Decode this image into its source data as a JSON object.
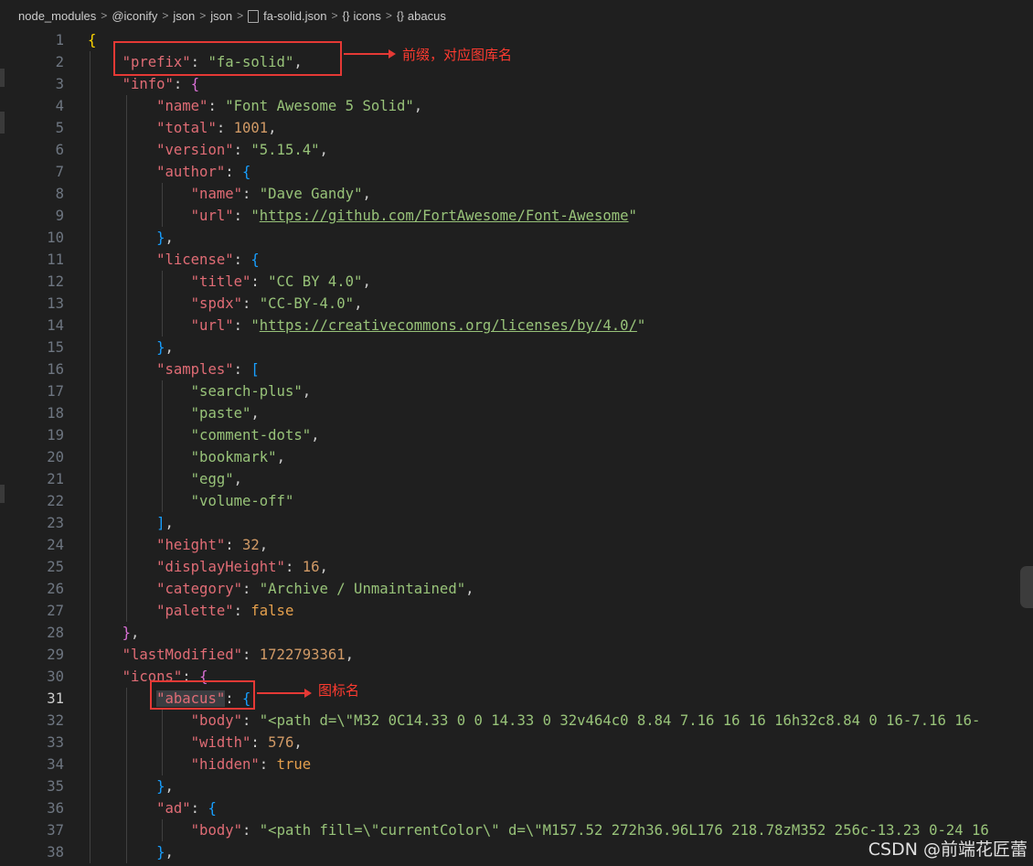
{
  "breadcrumb": [
    "node_modules",
    "@iconify",
    "json",
    "json",
    "fa-solid.json",
    "icons",
    "abacus"
  ],
  "annotations": {
    "prefix_note": "前缀，对应图库名",
    "icon_note": "图标名"
  },
  "watermark": "CSDN @前端花匠蕾",
  "active_line": 31,
  "lines": [
    [
      [
        "br1",
        "{"
      ]
    ],
    [
      [
        "k",
        "\"prefix\""
      ],
      [
        "p",
        ": "
      ],
      [
        "s",
        "\"fa-solid\""
      ],
      [
        "p",
        ","
      ]
    ],
    [
      [
        "k",
        "\"info\""
      ],
      [
        "p",
        ": "
      ],
      [
        "br2",
        "{"
      ]
    ],
    [
      [
        "k",
        "\"name\""
      ],
      [
        "p",
        ": "
      ],
      [
        "s",
        "\"Font Awesome 5 Solid\""
      ],
      [
        "p",
        ","
      ]
    ],
    [
      [
        "k",
        "\"total\""
      ],
      [
        "p",
        ": "
      ],
      [
        "n",
        "1001"
      ],
      [
        "p",
        ","
      ]
    ],
    [
      [
        "k",
        "\"version\""
      ],
      [
        "p",
        ": "
      ],
      [
        "s",
        "\"5.15.4\""
      ],
      [
        "p",
        ","
      ]
    ],
    [
      [
        "k",
        "\"author\""
      ],
      [
        "p",
        ": "
      ],
      [
        "br3",
        "{"
      ]
    ],
    [
      [
        "k",
        "\"name\""
      ],
      [
        "p",
        ": "
      ],
      [
        "s",
        "\"Dave Gandy\""
      ],
      [
        "p",
        ","
      ]
    ],
    [
      [
        "k",
        "\"url\""
      ],
      [
        "p",
        ": "
      ],
      [
        "s",
        "\""
      ],
      [
        "su",
        "https://github.com/FortAwesome/Font-Awesome"
      ],
      [
        "s",
        "\""
      ]
    ],
    [
      [
        "br3",
        "}"
      ],
      [
        "p",
        ","
      ]
    ],
    [
      [
        "k",
        "\"license\""
      ],
      [
        "p",
        ": "
      ],
      [
        "br3",
        "{"
      ]
    ],
    [
      [
        "k",
        "\"title\""
      ],
      [
        "p",
        ": "
      ],
      [
        "s",
        "\"CC BY 4.0\""
      ],
      [
        "p",
        ","
      ]
    ],
    [
      [
        "k",
        "\"spdx\""
      ],
      [
        "p",
        ": "
      ],
      [
        "s",
        "\"CC-BY-4.0\""
      ],
      [
        "p",
        ","
      ]
    ],
    [
      [
        "k",
        "\"url\""
      ],
      [
        "p",
        ": "
      ],
      [
        "s",
        "\""
      ],
      [
        "su",
        "https://creativecommons.org/licenses/by/4.0/"
      ],
      [
        "s",
        "\""
      ]
    ],
    [
      [
        "br3",
        "}"
      ],
      [
        "p",
        ","
      ]
    ],
    [
      [
        "k",
        "\"samples\""
      ],
      [
        "p",
        ": "
      ],
      [
        "br3",
        "["
      ]
    ],
    [
      [
        "s",
        "\"search-plus\""
      ],
      [
        "p",
        ","
      ]
    ],
    [
      [
        "s",
        "\"paste\""
      ],
      [
        "p",
        ","
      ]
    ],
    [
      [
        "s",
        "\"comment-dots\""
      ],
      [
        "p",
        ","
      ]
    ],
    [
      [
        "s",
        "\"bookmark\""
      ],
      [
        "p",
        ","
      ]
    ],
    [
      [
        "s",
        "\"egg\""
      ],
      [
        "p",
        ","
      ]
    ],
    [
      [
        "s",
        "\"volume-off\""
      ]
    ],
    [
      [
        "br3",
        "]"
      ],
      [
        "p",
        ","
      ]
    ],
    [
      [
        "k",
        "\"height\""
      ],
      [
        "p",
        ": "
      ],
      [
        "n",
        "32"
      ],
      [
        "p",
        ","
      ]
    ],
    [
      [
        "k",
        "\"displayHeight\""
      ],
      [
        "p",
        ": "
      ],
      [
        "n",
        "16"
      ],
      [
        "p",
        ","
      ]
    ],
    [
      [
        "k",
        "\"category\""
      ],
      [
        "p",
        ": "
      ],
      [
        "s",
        "\"Archive / Unmaintained\""
      ],
      [
        "p",
        ","
      ]
    ],
    [
      [
        "k",
        "\"palette\""
      ],
      [
        "p",
        ": "
      ],
      [
        "b",
        "false"
      ]
    ],
    [
      [
        "br2",
        "}"
      ],
      [
        "p",
        ","
      ]
    ],
    [
      [
        "k",
        "\"lastModified\""
      ],
      [
        "p",
        ": "
      ],
      [
        "n",
        "1722793361"
      ],
      [
        "p",
        ","
      ]
    ],
    [
      [
        "k",
        "\"icons\""
      ],
      [
        "p",
        ": "
      ],
      [
        "br2",
        "{"
      ]
    ],
    [
      [
        "kh",
        "\"abacus\""
      ],
      [
        "p",
        ": "
      ],
      [
        "br3",
        "{"
      ]
    ],
    [
      [
        "k",
        "\"body\""
      ],
      [
        "p",
        ": "
      ],
      [
        "s",
        "\"<path d=\\\"M32 0C14.33 0 0 14.33 0 32v464c0 8.84 7.16 16 16 16h32c8.84 0 16-7.16 16-"
      ]
    ],
    [
      [
        "k",
        "\"width\""
      ],
      [
        "p",
        ": "
      ],
      [
        "n",
        "576"
      ],
      [
        "p",
        ","
      ]
    ],
    [
      [
        "k",
        "\"hidden\""
      ],
      [
        "p",
        ": "
      ],
      [
        "b",
        "true"
      ]
    ],
    [
      [
        "br3",
        "}"
      ],
      [
        "p",
        ","
      ]
    ],
    [
      [
        "k",
        "\"ad\""
      ],
      [
        "p",
        ": "
      ],
      [
        "br3",
        "{"
      ]
    ],
    [
      [
        "k",
        "\"body\""
      ],
      [
        "p",
        ": "
      ],
      [
        "s",
        "\"<path fill=\\\"currentColor\\\" d=\\\"M157.52 272h36.96L176 218.78zM352 256c-13.23 0-24 16"
      ]
    ],
    [
      [
        "br3",
        "}"
      ],
      [
        "p",
        ","
      ]
    ]
  ]
}
